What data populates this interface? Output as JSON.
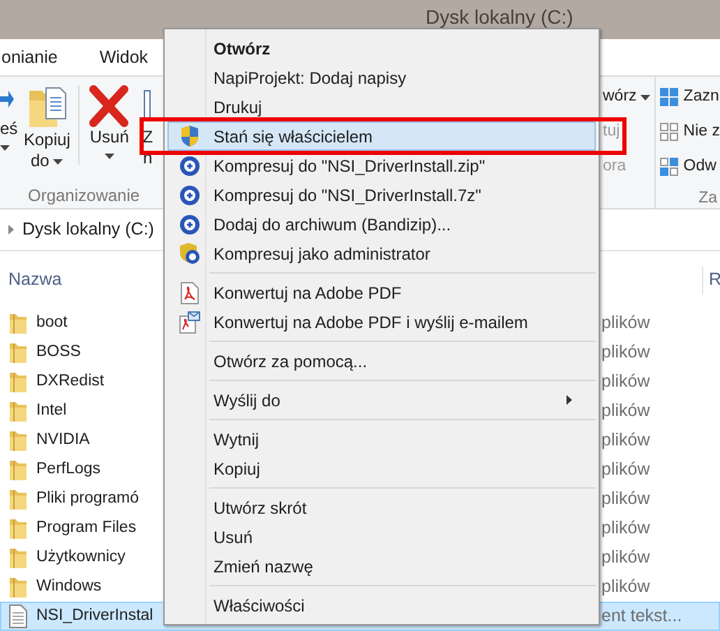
{
  "window": {
    "title": "Dysk lokalny (C:)"
  },
  "ribbon_tabs": [
    {
      "label": "onianie",
      "selected": false
    },
    {
      "label": "Widok",
      "selected": false
    }
  ],
  "ribbon_left": {
    "buttons": [
      {
        "kind": "move",
        "lines": [
          "eś"
        ],
        "dropdown": true
      },
      {
        "kind": "copy",
        "lines": [
          "Kopiuj",
          "do"
        ],
        "dropdown": true
      },
      {
        "kind": "delete",
        "lines": [
          "Usuń"
        ],
        "dropdown": true
      },
      {
        "kind": "rename",
        "lines": [
          "Z",
          "n"
        ],
        "dropdown": false
      }
    ],
    "group_label": "Organizowanie"
  },
  "ribbon_right": {
    "open_items": [
      {
        "label": "wórz",
        "dropdown": true
      },
      {
        "label": "tuj",
        "dropdown": false
      },
      {
        "label": "ora",
        "dropdown": false
      }
    ],
    "select_items": [
      {
        "kind": "all",
        "label": "Zazn"
      },
      {
        "kind": "none",
        "label": "Nie z"
      },
      {
        "kind": "invert",
        "label": "Odw"
      }
    ],
    "group_label": "Za"
  },
  "address": {
    "crumb": "Dysk lokalny (C:)"
  },
  "columns": {
    "name": "Nazwa",
    "column_2": "R"
  },
  "files": [
    {
      "name": "boot",
      "type": "plików",
      "kind": "folder",
      "selected": false
    },
    {
      "name": "BOSS",
      "type": "plików",
      "kind": "folder",
      "selected": false
    },
    {
      "name": "DXRedist",
      "type": "plików",
      "kind": "folder",
      "selected": false
    },
    {
      "name": "Intel",
      "type": "plików",
      "kind": "folder",
      "selected": false
    },
    {
      "name": "NVIDIA",
      "type": "plików",
      "kind": "folder",
      "selected": false
    },
    {
      "name": "PerfLogs",
      "type": "plików",
      "kind": "folder",
      "selected": false
    },
    {
      "name": "Pliki programó",
      "type": "plików",
      "kind": "folder",
      "selected": false
    },
    {
      "name": "Program Files",
      "type": "plików",
      "kind": "folder",
      "selected": false
    },
    {
      "name": "Użytkownicy",
      "type": "plików",
      "kind": "folder",
      "selected": false
    },
    {
      "name": "Windows",
      "type": "plików",
      "kind": "folder",
      "selected": false
    },
    {
      "name": "NSI_DriverInstal",
      "type": "ent tekst...",
      "kind": "text",
      "selected": true
    }
  ],
  "context_menu": [
    {
      "kind": "plain",
      "label": "Otwórz",
      "bold": true,
      "submenu": false,
      "selected": false
    },
    {
      "kind": "plain",
      "label": "NapiProjekt: Dodaj napisy",
      "bold": false,
      "submenu": false,
      "selected": false
    },
    {
      "kind": "plain",
      "label": "Drukuj",
      "bold": false,
      "submenu": false,
      "selected": false
    },
    {
      "kind": "shield",
      "label": "Stań się właścicielem",
      "bold": false,
      "submenu": false,
      "selected": true
    },
    {
      "kind": "archiver",
      "label": "Kompresuj do \"NSI_DriverInstall.zip\"",
      "bold": false,
      "submenu": false,
      "selected": false
    },
    {
      "kind": "archiver",
      "label": "Kompresuj do \"NSI_DriverInstall.7z\"",
      "bold": false,
      "submenu": false,
      "selected": false
    },
    {
      "kind": "archiver",
      "label": "Dodaj do archiwum (Bandizip)...",
      "bold": false,
      "submenu": false,
      "selected": false
    },
    {
      "kind": "adminarchiver",
      "label": "Kompresuj jako administrator",
      "bold": false,
      "submenu": false,
      "selected": false
    },
    {
      "kind": "separator"
    },
    {
      "kind": "pdf",
      "label": "Konwertuj na Adobe PDF",
      "bold": false,
      "submenu": false,
      "selected": false
    },
    {
      "kind": "pdfmail",
      "label": "Konwertuj na Adobe PDF i wyślij e-mailem",
      "bold": false,
      "submenu": false,
      "selected": false
    },
    {
      "kind": "separator"
    },
    {
      "kind": "plain",
      "label": "Otwórz za pomocą...",
      "bold": false,
      "submenu": false,
      "selected": false
    },
    {
      "kind": "separator"
    },
    {
      "kind": "plain",
      "label": "Wyślij do",
      "bold": false,
      "submenu": true,
      "selected": false
    },
    {
      "kind": "separator"
    },
    {
      "kind": "plain",
      "label": "Wytnij",
      "bold": false,
      "submenu": false,
      "selected": false
    },
    {
      "kind": "plain",
      "label": "Kopiuj",
      "bold": false,
      "submenu": false,
      "selected": false
    },
    {
      "kind": "separator"
    },
    {
      "kind": "plain",
      "label": "Utwórz skrót",
      "bold": false,
      "submenu": false,
      "selected": false
    },
    {
      "kind": "plain",
      "label": "Usuń",
      "bold": false,
      "submenu": false,
      "selected": false
    },
    {
      "kind": "plain",
      "label": "Zmień nazwę",
      "bold": false,
      "submenu": false,
      "selected": false
    },
    {
      "kind": "separator"
    },
    {
      "kind": "plain",
      "label": "Właściwości",
      "bold": false,
      "submenu": false,
      "selected": false
    }
  ]
}
